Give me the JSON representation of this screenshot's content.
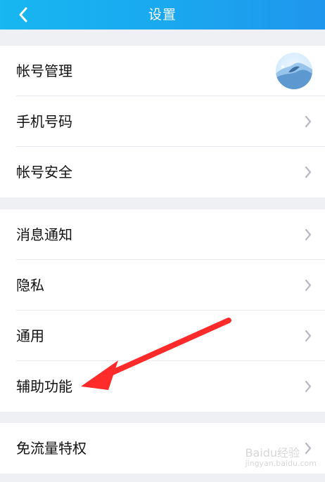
{
  "header": {
    "title": "设置",
    "back_icon": "chevron-left-icon"
  },
  "groups": [
    {
      "items": [
        {
          "label": "帐号管理",
          "trailing": "avatar"
        },
        {
          "label": "手机号码",
          "trailing": "chevron-right-icon"
        },
        {
          "label": "帐号安全",
          "trailing": "chevron-right-icon"
        }
      ]
    },
    {
      "items": [
        {
          "label": "消息通知",
          "trailing": "chevron-right-icon"
        },
        {
          "label": "隐私",
          "trailing": "chevron-right-icon"
        },
        {
          "label": "通用",
          "trailing": "chevron-right-icon"
        },
        {
          "label": "辅助功能",
          "trailing": "chevron-right-icon"
        }
      ]
    },
    {
      "items": [
        {
          "label": "免流量特权",
          "trailing": "chevron-right-icon"
        }
      ]
    }
  ],
  "colors": {
    "header_gradient_start": "#17b7f1",
    "header_gradient_end": "#1f96ed",
    "background": "#eef0f3",
    "arrow": "#ff2a2a"
  },
  "watermark": {
    "brand": "Baidu经验",
    "sub": "jingyan.baidu.com"
  }
}
